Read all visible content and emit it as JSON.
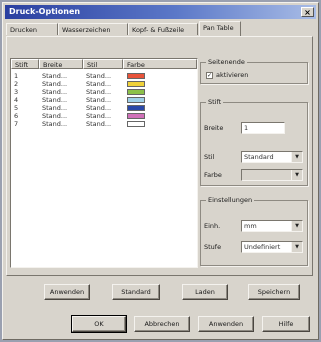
{
  "window": {
    "title": "Druck-Optionen",
    "close_label": "×"
  },
  "tabs": [
    {
      "label": "Drucken"
    },
    {
      "label": "Wasserzeichen"
    },
    {
      "label": "Kopf- & Fußzeile"
    },
    {
      "label": "Pan Table"
    }
  ],
  "list": {
    "columns": [
      "Stift",
      "Breite",
      "Stil",
      "Farbe"
    ],
    "rows": [
      {
        "stift": "1",
        "breite": "Stand...",
        "stil": "Stand...",
        "color": "#e8533a"
      },
      {
        "stift": "2",
        "breite": "Stand...",
        "stil": "Stand...",
        "color": "#f0d23a"
      },
      {
        "stift": "3",
        "breite": "Stand...",
        "stil": "Stand...",
        "color": "#8cc04a"
      },
      {
        "stift": "4",
        "breite": "Stand...",
        "stil": "Stand...",
        "color": "#9fd0e8"
      },
      {
        "stift": "5",
        "breite": "Stand...",
        "stil": "Stand...",
        "color": "#2a48a8"
      },
      {
        "stift": "6",
        "breite": "Stand...",
        "stil": "Stand...",
        "color": "#d070b8"
      },
      {
        "stift": "7",
        "breite": "Stand...",
        "stil": "Stand...",
        "color": "#ffffff"
      }
    ]
  },
  "sidebar": {
    "tabelle_group": "Seitenende",
    "aktivieren_label": "aktivieren",
    "stift_group": "Stift",
    "breite_label": "Breite",
    "breite_value": "1",
    "stil_label": "Stil",
    "stil_value": "Standard",
    "farbe_label": "Farbe",
    "farbe_value": "",
    "einstellungen_group": "Einstellungen",
    "einh_label": "Einh.",
    "einh_value": "mm",
    "stufe_label": "Stufe",
    "stufe_value": "Undefiniert"
  },
  "panel_buttons": {
    "anwenden": "Anwenden",
    "standard": "Standard",
    "laden": "Laden",
    "speichern": "Speichern"
  },
  "dialog_buttons": {
    "ok": "OK",
    "abbrechen": "Abbrechen",
    "anwenden": "Anwenden",
    "hilfe": "Hilfe"
  },
  "icons": {
    "dropdown": "chevron-down-icon",
    "check": "checkmark-icon"
  }
}
